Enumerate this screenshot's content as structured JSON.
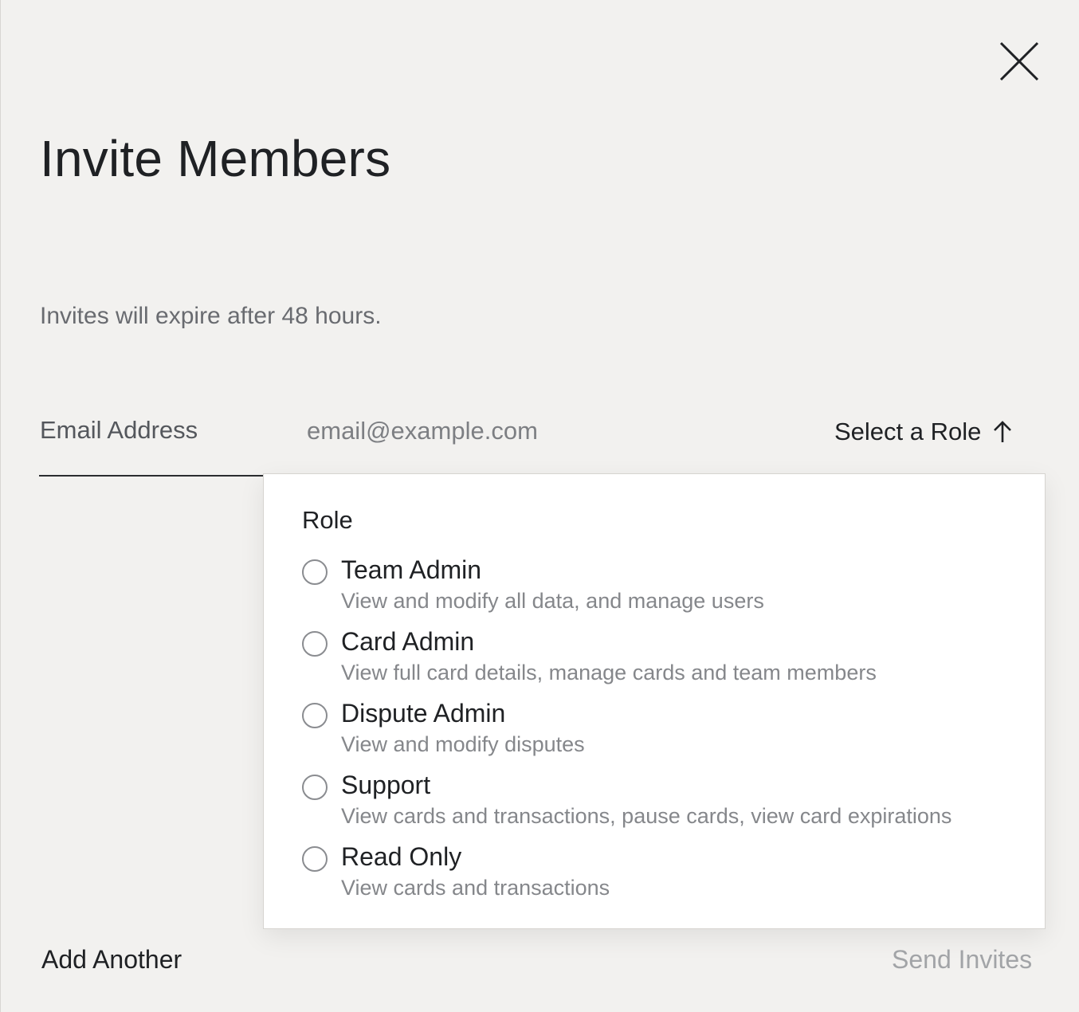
{
  "modal": {
    "title": "Invite Members",
    "subtitle": "Invites will expire after 48 hours.",
    "close_icon": "close-icon"
  },
  "form": {
    "email_label": "Email Address",
    "email_placeholder": "email@example.com",
    "email_value": "",
    "role_select_label": "Select a Role",
    "role_select_icon": "arrow-up-icon"
  },
  "role_dropdown": {
    "title": "Role",
    "options": [
      {
        "label": "Team Admin",
        "description": "View and modify all data, and manage users",
        "selected": false
      },
      {
        "label": "Card Admin",
        "description": "View full card details, manage cards and team members",
        "selected": false
      },
      {
        "label": "Dispute Admin",
        "description": "View and modify disputes",
        "selected": false
      },
      {
        "label": "Support",
        "description": "View cards and transactions, pause cards, view card expirations",
        "selected": false
      },
      {
        "label": "Read Only",
        "description": "View cards and transactions",
        "selected": false
      }
    ]
  },
  "footer": {
    "add_another_label": "Add Another",
    "send_invites_label": "Send Invites"
  },
  "colors": {
    "background": "#f2f1ef",
    "text_primary": "#1f2124",
    "text_muted": "#85878b",
    "disabled": "#a2a4a7"
  }
}
